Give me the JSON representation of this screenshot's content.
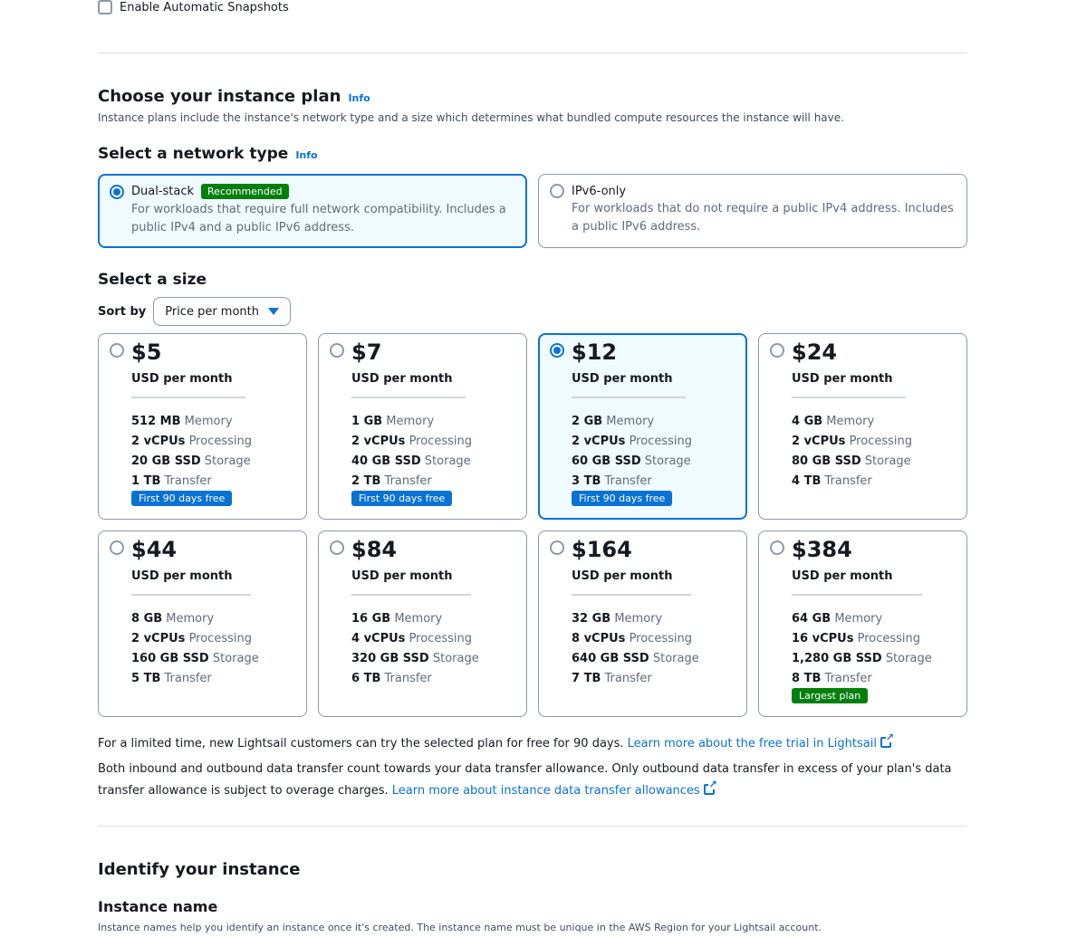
{
  "snapshot": {
    "label": "Enable Automatic Snapshots"
  },
  "plan_section": {
    "title": "Choose your instance plan",
    "info": "Info",
    "description": "Instance plans include the instance's network type and a size which determines what bundled compute resources the instance will have."
  },
  "network": {
    "title": "Select a network type",
    "info": "Info",
    "options": [
      {
        "name": "Dual-stack",
        "badge": "Recommended",
        "desc": "For workloads that require full network compatibility. Includes a public IPv4 and a public IPv6 address.",
        "selected": true
      },
      {
        "name": "IPv6-only",
        "badge": "",
        "desc": "For workloads that do not require a public IPv4 address. Includes a public IPv6 address.",
        "selected": false
      }
    ]
  },
  "size": {
    "title": "Select a size",
    "sort_label": "Sort by",
    "sort_value": "Price per month"
  },
  "plans": [
    {
      "price": "$5",
      "unit": "USD per month",
      "memory": "512 MB",
      "memory_label": "Memory",
      "cpu": "2 vCPUs",
      "cpu_label": "Processing",
      "storage": "20 GB SSD",
      "storage_label": "Storage",
      "transfer": "1 TB",
      "transfer_label": "Transfer",
      "badge": "First 90 days free"
    },
    {
      "price": "$7",
      "unit": "USD per month",
      "memory": "1 GB",
      "memory_label": "Memory",
      "cpu": "2 vCPUs",
      "cpu_label": "Processing",
      "storage": "40 GB SSD",
      "storage_label": "Storage",
      "transfer": "2 TB",
      "transfer_label": "Transfer",
      "badge": "First 90 days free"
    },
    {
      "price": "$12",
      "unit": "USD per month",
      "memory": "2 GB",
      "memory_label": "Memory",
      "cpu": "2 vCPUs",
      "cpu_label": "Processing",
      "storage": "60 GB SSD",
      "storage_label": "Storage",
      "transfer": "3 TB",
      "transfer_label": "Transfer",
      "badge": "First 90 days free",
      "selected": true
    },
    {
      "price": "$24",
      "unit": "USD per month",
      "memory": "4 GB",
      "memory_label": "Memory",
      "cpu": "2 vCPUs",
      "cpu_label": "Processing",
      "storage": "80 GB SSD",
      "storage_label": "Storage",
      "transfer": "4 TB",
      "transfer_label": "Transfer"
    },
    {
      "price": "$44",
      "unit": "USD per month",
      "memory": "8 GB",
      "memory_label": "Memory",
      "cpu": "2 vCPUs",
      "cpu_label": "Processing",
      "storage": "160 GB SSD",
      "storage_label": "Storage",
      "transfer": "5 TB",
      "transfer_label": "Transfer"
    },
    {
      "price": "$84",
      "unit": "USD per month",
      "memory": "16 GB",
      "memory_label": "Memory",
      "cpu": "4 vCPUs",
      "cpu_label": "Processing",
      "storage": "320 GB SSD",
      "storage_label": "Storage",
      "transfer": "6 TB",
      "transfer_label": "Transfer"
    },
    {
      "price": "$164",
      "unit": "USD per month",
      "memory": "32 GB",
      "memory_label": "Memory",
      "cpu": "8 vCPUs",
      "cpu_label": "Processing",
      "storage": "640 GB SSD",
      "storage_label": "Storage",
      "transfer": "7 TB",
      "transfer_label": "Transfer"
    },
    {
      "price": "$384",
      "unit": "USD per month",
      "memory": "64 GB",
      "memory_label": "Memory",
      "cpu": "16 vCPUs",
      "cpu_label": "Processing",
      "storage": "1,280 GB SSD",
      "storage_label": "Storage",
      "transfer": "8 TB",
      "transfer_label": "Transfer",
      "largest": "Largest plan"
    }
  ],
  "notes": {
    "trial_text": "For a limited time, new Lightsail customers can try the selected plan for free for 90 days.",
    "trial_link": "Learn more about the free trial in Lightsail",
    "transfer_text": "Both inbound and outbound data transfer count towards your data transfer allowance. Only outbound data transfer in excess of your plan's data transfer allowance is subject to overage charges.",
    "transfer_link": "Learn more about instance data transfer allowances"
  },
  "identify": {
    "title": "Identify your instance",
    "name_title": "Instance name",
    "name_desc": "Instance names help you identify an instance once it's created. The instance name must be unique in the AWS Region for your Lightsail account."
  },
  "colors": {
    "accent": "#0972d3",
    "success": "#037f0c",
    "selected_bg": "#f0fbff"
  }
}
